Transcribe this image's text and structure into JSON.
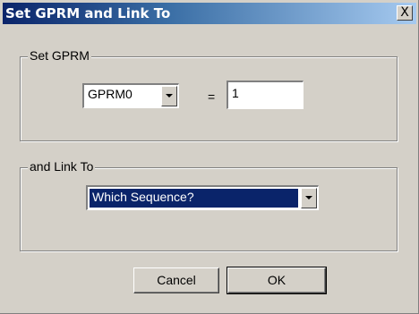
{
  "window": {
    "title": "Set GPRM and Link To",
    "close_glyph": "X"
  },
  "set_gprm": {
    "group_label": "Set GPRM",
    "register_selected": "GPRM0",
    "equals_sign": "=",
    "value": "1"
  },
  "link_to": {
    "group_label": "and Link To",
    "target_selected": "Which Sequence?"
  },
  "buttons": {
    "cancel_label": "Cancel",
    "ok_label": "OK"
  },
  "colors": {
    "titlebar_start": "#0a246a",
    "titlebar_end": "#a6caf0",
    "dialog_face": "#d4d0c8",
    "selection": "#0a246a"
  },
  "icons": {
    "dropdown": "chevron-down-icon",
    "close": "close-icon"
  }
}
